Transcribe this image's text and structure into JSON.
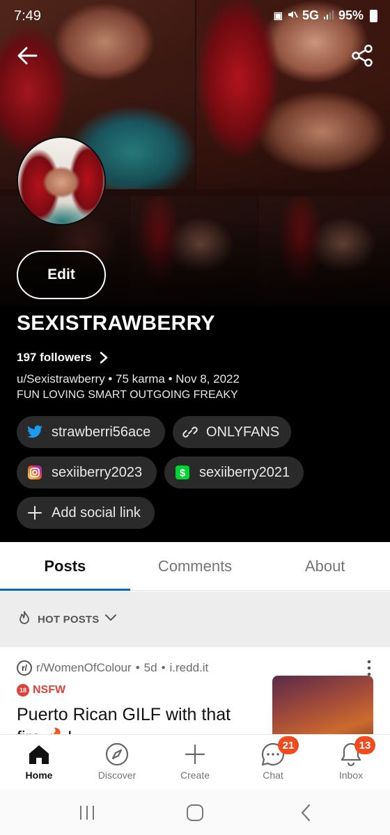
{
  "status_bar": {
    "time": "7:49",
    "network": "5G",
    "battery": "95%"
  },
  "header": {
    "back_icon": "arrow-left-icon",
    "share_icon": "share-icon"
  },
  "profile": {
    "edit_label": "Edit",
    "display_name": "SEXISTRAWBERRY",
    "followers": "197 followers",
    "meta": "u/Sexistrawberry • 75 karma • Nov 8, 2022",
    "bio": "FUN LOVING SMART OUTGOING FREAKY"
  },
  "social_links": {
    "twitter": "strawberri56ace",
    "onlyfans": "ONLYFANS",
    "instagram": "sexiiberry2023",
    "cashapp": "sexiiberry2021",
    "add": "Add social link"
  },
  "tabs": [
    "Posts",
    "Comments",
    "About"
  ],
  "sort": {
    "label": "HOT POSTS"
  },
  "post": {
    "subreddit": "r/WomenOfColour",
    "age": "5d",
    "domain": "i.redd.it",
    "nsfw": "NSFW",
    "title": "Puerto Rican GILF with that fire 🔥!"
  },
  "bottom_nav": {
    "home": "Home",
    "discover": "Discover",
    "create": "Create",
    "chat": "Chat",
    "chat_badge": "21",
    "inbox": "Inbox",
    "inbox_badge": "13"
  },
  "colors": {
    "accent_blue": "#0a66c2",
    "badge_orange": "#ef4b1f",
    "nsfw_red": "#e0413a",
    "chip_bg": "#2a2a2a"
  }
}
